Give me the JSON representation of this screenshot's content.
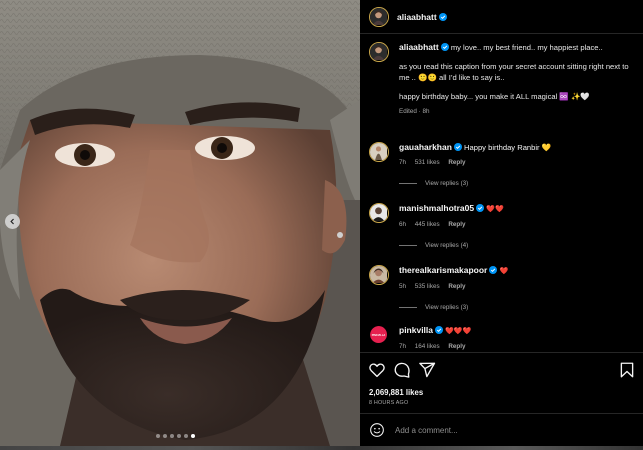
{
  "photo": {
    "alt": "Portrait of man in grey beanie",
    "carousel_dots": 6,
    "active_dot": 5,
    "prev_icon": "chevron-left-icon"
  },
  "header": {
    "username": "aliaabhatt",
    "verified_icon": "verified-badge-icon"
  },
  "caption": {
    "username": "aliaabhatt",
    "line1": "my love.. my best friend.. my happiest place..",
    "line2": "as you read this caption from your secret account sitting right next to me .. 🙂🙂 all I’d like to say is..",
    "line3": "happy birthday baby... you make it ALL magical ♾️ ✨🤍",
    "edited": "Edited · 8h"
  },
  "comments": [
    {
      "username": "gauaharkhan",
      "text": "Happy birthday Ranbir 💛",
      "time": "7h",
      "likes": "531 likes",
      "reply": "Reply",
      "view_replies": "View replies (3)"
    },
    {
      "username": "manishmalhotra05",
      "text": "❤️❤️",
      "time": "6h",
      "likes": "445 likes",
      "reply": "Reply",
      "view_replies": "View replies (4)"
    },
    {
      "username": "therealkarismakapoor",
      "text": "❤️",
      "time": "5h",
      "likes": "535 likes",
      "reply": "Reply",
      "view_replies": "View replies (3)"
    },
    {
      "username": "pinkvilla",
      "text": "❤️❤️❤️",
      "time": "7h",
      "likes": "164 likes",
      "reply": "Reply",
      "avatar_text": "PINKVILLA"
    }
  ],
  "actions": {
    "like_icon": "heart-icon",
    "comment_icon": "comment-icon",
    "share_icon": "send-icon",
    "save_icon": "bookmark-icon",
    "likes": "2,069,881 likes",
    "time_ago": "8 HOURS AGO"
  },
  "add_comment": {
    "emoji_icon": "emoji-icon",
    "placeholder": "Add a comment..."
  },
  "colors": {
    "background": "#000000",
    "text": "#f5f5f5",
    "muted": "#a8a8a8",
    "heart_red": "#ff3040",
    "verified_blue": "#0095f6"
  }
}
